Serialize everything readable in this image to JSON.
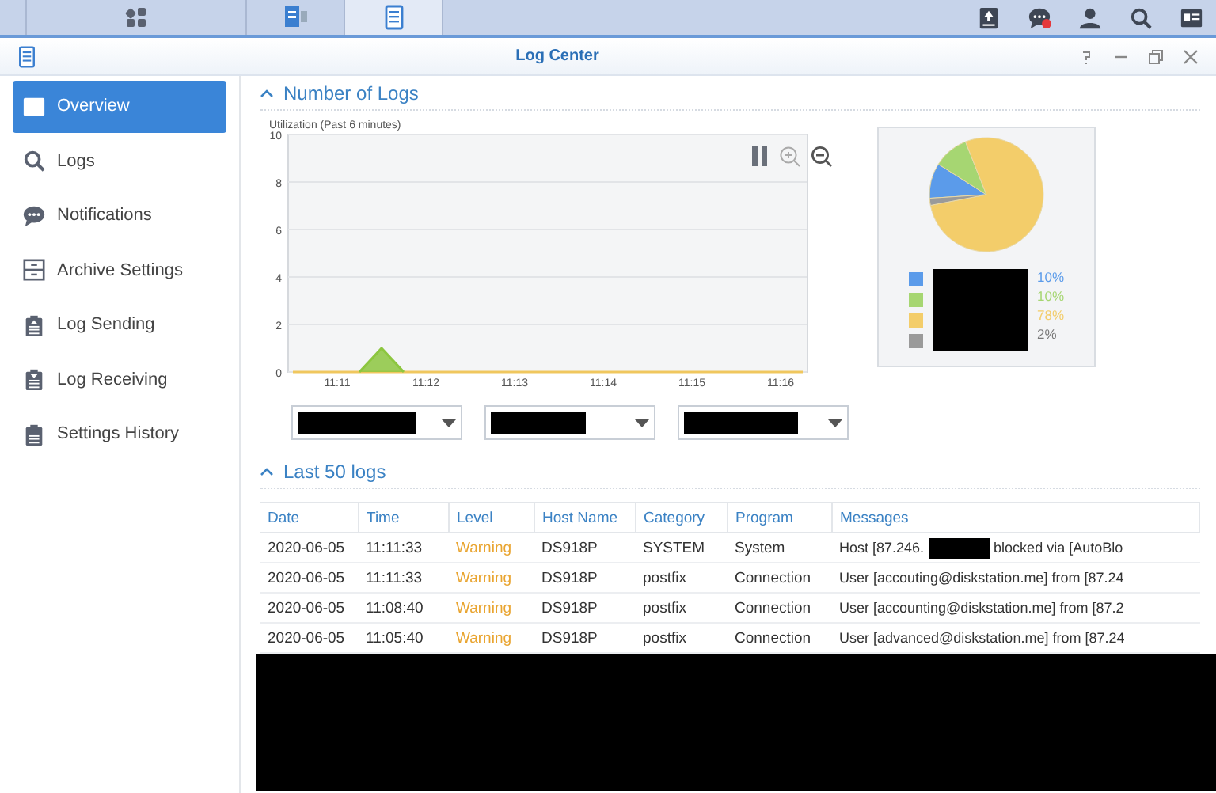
{
  "taskbar": {
    "left_apps": [
      {
        "kind": "grid",
        "selected": false
      },
      {
        "kind": "monitor",
        "selected": false
      },
      {
        "kind": "log",
        "selected": true
      }
    ],
    "right_icons": [
      {
        "kind": "upload",
        "badge": false
      },
      {
        "kind": "chat",
        "badge": true
      },
      {
        "kind": "user",
        "badge": false
      },
      {
        "kind": "search",
        "badge": false
      },
      {
        "kind": "card",
        "badge": false
      }
    ]
  },
  "window": {
    "title": "Log Center"
  },
  "sidebar": {
    "items": [
      {
        "label": "Overview",
        "kind": "card",
        "selected": true
      },
      {
        "label": "Logs",
        "kind": "search",
        "selected": false
      },
      {
        "label": "Notifications",
        "kind": "chat",
        "selected": false
      },
      {
        "label": "Archive Settings",
        "kind": "drawer",
        "selected": false
      },
      {
        "label": "Log Sending",
        "kind": "clipboard-up",
        "selected": false
      },
      {
        "label": "Log Receiving",
        "kind": "clipboard-down",
        "selected": false
      },
      {
        "label": "Settings History",
        "kind": "clipboard",
        "selected": false
      }
    ]
  },
  "number_of_logs": {
    "title": "Number of Logs",
    "expanded": true,
    "chart_subtitle": "Utilization (Past 6 minutes)",
    "chart_data": {
      "type": "line",
      "categories": [
        null,
        null,
        "11:11",
        null,
        null,
        null,
        "11:12",
        null,
        null,
        null,
        "11:13",
        null,
        null,
        null,
        "11:14",
        null,
        null,
        null,
        "11:15",
        null,
        null,
        null,
        "11:16",
        null
      ],
      "series": [
        {
          "color": "#f0c75e",
          "values": [
            0,
            0,
            0,
            0,
            0,
            0,
            0,
            0,
            0,
            0,
            0,
            0,
            0,
            0,
            0,
            0,
            0,
            0,
            0,
            0,
            0,
            0,
            0,
            0
          ]
        },
        {
          "color": "#8cc63f",
          "values": [
            null,
            null,
            null,
            0,
            1,
            0,
            null,
            null,
            null,
            null,
            null,
            null,
            null,
            null,
            null,
            null,
            null,
            null,
            null,
            null,
            null,
            null,
            null,
            null
          ]
        }
      ],
      "ylim": [
        0,
        10
      ],
      "grid": true,
      "yticks": [
        0,
        2,
        4,
        6,
        8,
        10
      ]
    },
    "dropdowns": [
      {
        "redacted": true
      },
      {
        "redacted": true
      },
      {
        "redacted": true
      }
    ],
    "pie": {
      "chart_data": {
        "type": "pie",
        "values": [
          10,
          10,
          78,
          2
        ],
        "colors": [
          "#5b9bea",
          "#a6d672",
          "#f3cd6a",
          "#9a9a9a"
        ]
      },
      "legend": [
        {
          "color": "#5b9bea",
          "percent": "10%"
        },
        {
          "color": "#a6d672",
          "percent": "10%"
        },
        {
          "color": "#f3cd6a",
          "percent": "78%"
        },
        {
          "color": "#9a9a9a",
          "percent": "2%"
        }
      ]
    }
  },
  "last_logs": {
    "title": "Last 50 logs",
    "expanded": true,
    "columns": [
      "Date",
      "Time",
      "Level",
      "Host Name",
      "Category",
      "Program",
      "Messages"
    ],
    "rows": [
      {
        "date": "2020-06-05",
        "time": "11:11:33",
        "level": "Warning",
        "host": "DS918P",
        "category": "SYSTEM",
        "program": "System",
        "message": [
          {
            "kind": "text",
            "text": "Host [87.246."
          },
          {
            "kind": "redacted"
          },
          {
            "kind": "text",
            "text": "blocked via [AutoBlo"
          }
        ]
      },
      {
        "date": "2020-06-05",
        "time": "11:11:33",
        "level": "Warning",
        "host": "DS918P",
        "category": "postfix",
        "program": "Connection",
        "message": [
          {
            "kind": "text",
            "text": "User [accouting@diskstation.me] from [87.24"
          }
        ]
      },
      {
        "date": "2020-06-05",
        "time": "11:08:40",
        "level": "Warning",
        "host": "DS918P",
        "category": "postfix",
        "program": "Connection",
        "message": [
          {
            "kind": "text",
            "text": "User [accounting@diskstation.me] from [87.2"
          }
        ]
      },
      {
        "date": "2020-06-05",
        "time": "11:05:40",
        "level": "Warning",
        "host": "DS918P",
        "category": "postfix",
        "program": "Connection",
        "message": [
          {
            "kind": "text",
            "text": "User [advanced@diskstation.me] from [87.24"
          }
        ]
      }
    ],
    "redacted_below": true
  }
}
